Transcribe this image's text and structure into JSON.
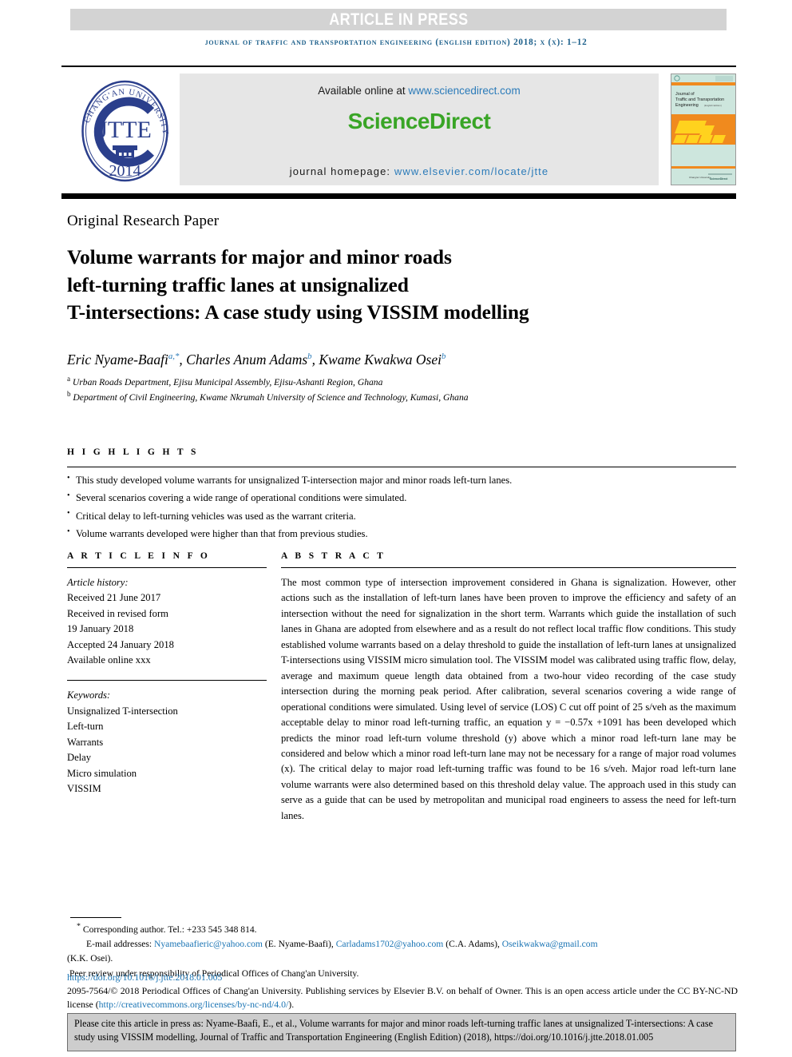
{
  "banner": {
    "text": "ARTICLE IN PRESS",
    "bg_color": "#d3d3d3",
    "text_color": "#ffffff"
  },
  "running_head": "JOURNAL OF TRAFFIC AND TRANSPORTATION ENGINEERING (ENGLISH EDITION) 2018; X (X): 1–12",
  "masthead": {
    "seal": {
      "outer_text": "CHANG'AN UNIVERSITY",
      "center_text": "JTTE",
      "year": "2014",
      "color": "#2b3f8c"
    },
    "sciencedirect": {
      "available_prefix": "Available online at ",
      "available_link": "www.sciencedirect.com",
      "logo_text": "ScienceDirect",
      "logo_color": "#39a526",
      "homepage_prefix": "journal homepage: ",
      "homepage_link": "www.elsevier.com/locate/jtte",
      "link_color": "#2b7bb9",
      "bg_color": "#e6e6e6"
    },
    "cover": {
      "title_line1": "Journal of",
      "title_line2": "Traffic and Transportation",
      "title_line3": "Engineering",
      "title_line3_suffix": "(English Edition)",
      "publisher": "Chang'an University",
      "brand": "ScienceDirect",
      "bg_color": "#cde6dd",
      "band_color": "#f08a1e",
      "shape_color": "#ffd21e"
    }
  },
  "article_type": "Original Research Paper",
  "title": "Volume warrants for major and minor roads left-turning traffic lanes at unsignalized T-intersections: A case study using VISSIM modelling",
  "title_lines": [
    "Volume warrants for major and minor roads",
    "left-turning traffic lanes at unsignalized",
    "T-intersections: A case study using VISSIM modelling"
  ],
  "authors": [
    {
      "name": "Eric Nyame-Baafi",
      "marks": "a,*"
    },
    {
      "name": "Charles Anum Adams",
      "marks": "b"
    },
    {
      "name": "Kwame Kwakwa Osei",
      "marks": "b"
    }
  ],
  "affiliations": [
    {
      "mark": "a",
      "text": "Urban Roads Department, Ejisu Municipal Assembly, Ejisu-Ashanti Region, Ghana"
    },
    {
      "mark": "b",
      "text": "Department of Civil Engineering, Kwame Nkrumah University of Science and Technology, Kumasi, Ghana"
    }
  ],
  "highlights": {
    "heading": "H I G H L I G H T S",
    "items": [
      "This study developed volume warrants for unsignalized T-intersection major and minor roads left-turn lanes.",
      "Several scenarios covering a wide range of operational conditions were simulated.",
      "Critical delay to left-turning vehicles was used as the warrant criteria.",
      "Volume warrants developed were higher than that from previous studies."
    ]
  },
  "article_info": {
    "heading": "A R T I C L E  I N F O",
    "history_label": "Article history:",
    "history_lines": [
      "Received 21 June 2017",
      "Received in revised form",
      "19 January 2018",
      "Accepted 24 January 2018",
      "Available online xxx"
    ],
    "keywords_label": "Keywords:",
    "keywords": [
      "Unsignalized T-intersection",
      "Left-turn",
      "Warrants",
      "Delay",
      "Micro simulation",
      "VISSIM"
    ]
  },
  "abstract": {
    "heading": "A B S T R A C T",
    "text": "The most common type of intersection improvement considered in Ghana is signalization. However, other actions such as the installation of left-turn lanes have been proven to improve the efficiency and safety of an intersection without the need for signalization in the short term. Warrants which guide the installation of such lanes in Ghana are adopted from elsewhere and as a result do not reflect local traffic flow conditions. This study established volume warrants based on a delay threshold to guide the installation of left-turn lanes at unsignalized T-intersections using VISSIM micro simulation tool. The VISSIM model was calibrated using traffic flow, delay, average and maximum queue length data obtained from a two-hour video recording of the case study intersection during the morning peak period. After calibration, several scenarios covering a wide range of operational conditions were simulated. Using level of service (LOS) C cut off point of 25 s/veh as the maximum acceptable delay to minor road left-turning traffic, an equation y = −0.57x +1091 has been developed which predicts the minor road left-turn volume threshold (y) above which a minor road left-turn lane may be considered and below which a minor road left-turn lane may not be necessary for a range of major road volumes (x). The critical delay to major road left-turning traffic was found to be 16 s/veh. Major road left-turn lane volume warrants were also determined based on this threshold delay value. The approach used in this study can serve as a guide that can be used by metropolitan and municipal road engineers to assess the need for left-turn lanes."
  },
  "footnotes": {
    "corresponding": "Corresponding author. Tel.: +233 545 348 814.",
    "email_label": "E-mail addresses:",
    "emails": [
      {
        "address": "Nyamebaafieric@yahoo.com",
        "owner": "(E. Nyame-Baafi),"
      },
      {
        "address": "Carladams1702@yahoo.com",
        "owner": "(C.A. Adams),"
      },
      {
        "address": "Oseikwakwa@gmail.com",
        "owner": ""
      }
    ],
    "email_tail": "(K.K. Osei).",
    "peer_review": "Peer review under responsibility of Periodical Offices of Chang'an University.",
    "doi": "https://doi.org/10.1016/j.jtte.2018.01.005",
    "copyright_part1": "2095-7564/© 2018 Periodical Offices of Chang'an University. Publishing services by Elsevier B.V. on behalf of Owner. This is an open access article under the CC BY-NC-ND license (",
    "copyright_link": "http://creativecommons.org/licenses/by-nc-nd/4.0/",
    "copyright_part2": ")."
  },
  "cite_box": {
    "text": "Please cite this article in press as: Nyame-Baafi, E., et al., Volume warrants for major and minor roads left-turning traffic lanes at unsignalized T-intersections: A case study using VISSIM modelling, Journal of Traffic and Transportation Engineering (English Edition) (2018), https://doi.org/10.1016/j.jtte.2018.01.005",
    "bg_color": "#cdcdcd"
  }
}
